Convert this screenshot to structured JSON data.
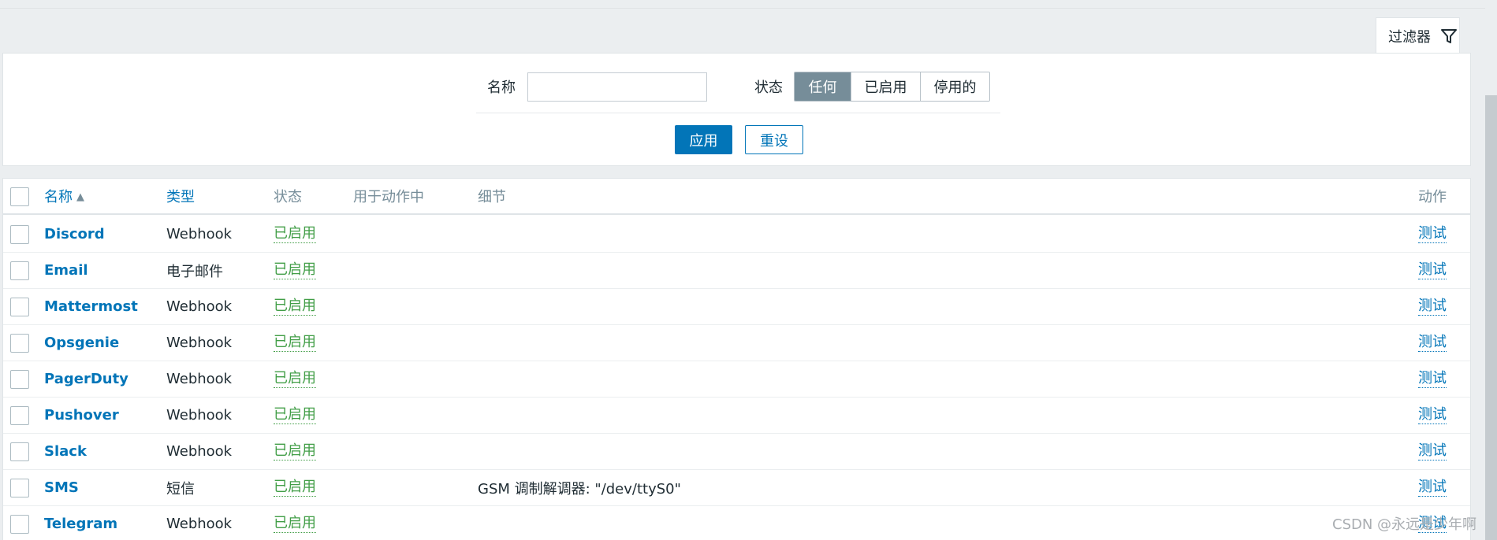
{
  "filter": {
    "tab_label": "过滤器",
    "name_label": "名称",
    "name_value": "",
    "name_placeholder": "",
    "status_label": "状态",
    "status_options": [
      "任何",
      "已启用",
      "停用的"
    ],
    "status_selected": "任何",
    "apply_label": "应用",
    "reset_label": "重设"
  },
  "table": {
    "headers": {
      "name": "名称",
      "type": "类型",
      "status": "状态",
      "used_in_actions": "用于动作中",
      "details": "细节",
      "action": "动作"
    },
    "sort_indicator": "▲",
    "rows": [
      {
        "name": "Discord",
        "type": "Webhook",
        "status": "已启用",
        "details": "",
        "action": "测试"
      },
      {
        "name": "Email",
        "type": "电子邮件",
        "status": "已启用",
        "details": "",
        "action": "测试"
      },
      {
        "name": "Mattermost",
        "type": "Webhook",
        "status": "已启用",
        "details": "",
        "action": "测试"
      },
      {
        "name": "Opsgenie",
        "type": "Webhook",
        "status": "已启用",
        "details": "",
        "action": "测试"
      },
      {
        "name": "PagerDuty",
        "type": "Webhook",
        "status": "已启用",
        "details": "",
        "action": "测试"
      },
      {
        "name": "Pushover",
        "type": "Webhook",
        "status": "已启用",
        "details": "",
        "action": "测试"
      },
      {
        "name": "Slack",
        "type": "Webhook",
        "status": "已启用",
        "details": "",
        "action": "测试"
      },
      {
        "name": "SMS",
        "type": "短信",
        "status": "已启用",
        "details": "GSM 调制解调器: \"/dev/ttyS0\"",
        "action": "测试"
      },
      {
        "name": "Telegram",
        "type": "Webhook",
        "status": "已启用",
        "details": "",
        "action": "测试"
      }
    ]
  },
  "watermark": "CSDN @永远是少年啊",
  "colors": {
    "link": "#0275b8",
    "enabled": "#429e47",
    "segment_active": "#768d99",
    "background": "#ebeef0"
  }
}
